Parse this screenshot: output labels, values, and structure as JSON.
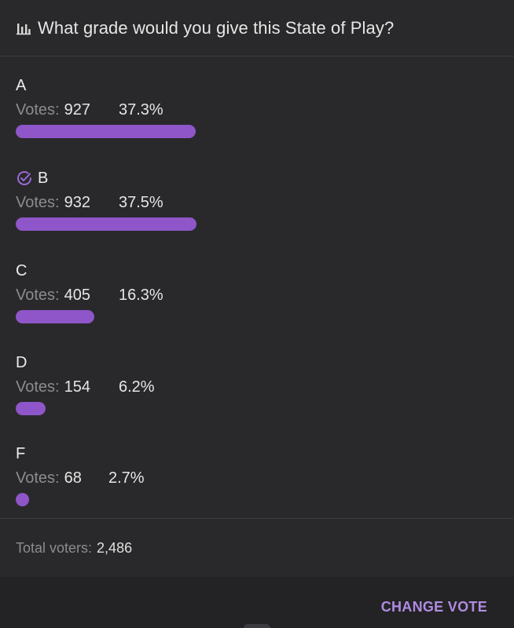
{
  "poll": {
    "icon": "bar-chart-icon",
    "title": "What grade would you give this State of Play?",
    "votes_prefix": "Votes:",
    "accent_color": "#8e56c8",
    "options": [
      {
        "label": "A",
        "votes": "927",
        "percent": "37.3%",
        "share": 0.373,
        "selected": false
      },
      {
        "label": "B",
        "votes": "932",
        "percent": "37.5%",
        "share": 0.375,
        "selected": true,
        "selected_icon": "check-circle-icon"
      },
      {
        "label": "C",
        "votes": "405",
        "percent": "16.3%",
        "share": 0.163,
        "selected": false
      },
      {
        "label": "D",
        "votes": "154",
        "percent": "6.2%",
        "share": 0.062,
        "selected": false
      },
      {
        "label": "F",
        "votes": "68",
        "percent": "2.7%",
        "share": 0.027,
        "selected": false
      }
    ],
    "total_prefix": "Total voters:",
    "total_value": "2,486"
  },
  "actions": {
    "change_vote_label": "CHANGE VOTE",
    "change_vote_color": "#b08be0"
  }
}
